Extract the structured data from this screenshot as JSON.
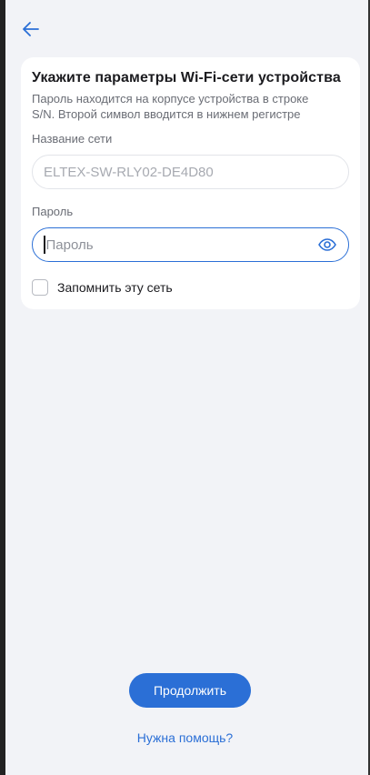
{
  "header": {
    "back_icon": "arrow-left-icon"
  },
  "card": {
    "title": "Укажите параметры Wi-Fi-сети устройства",
    "description_line1": "Пароль находится на корпусе устройства в строке",
    "description_line2": "S/N. Второй символ вводится в нижнем регистре",
    "network_label": "Название сети",
    "network_value": "ELTEX-SW-RLY02-DE4D80",
    "password_label": "Пароль",
    "password_placeholder": "Пароль",
    "password_value": "",
    "eye_icon": "eye-icon",
    "remember_label": "Запомнить эту сеть",
    "remember_checked": false
  },
  "footer": {
    "continue_label": "Продолжить",
    "help_label": "Нужна помощь?"
  },
  "colors": {
    "accent": "#2b6fd6",
    "background": "#f2f3f7",
    "card": "#ffffff"
  }
}
